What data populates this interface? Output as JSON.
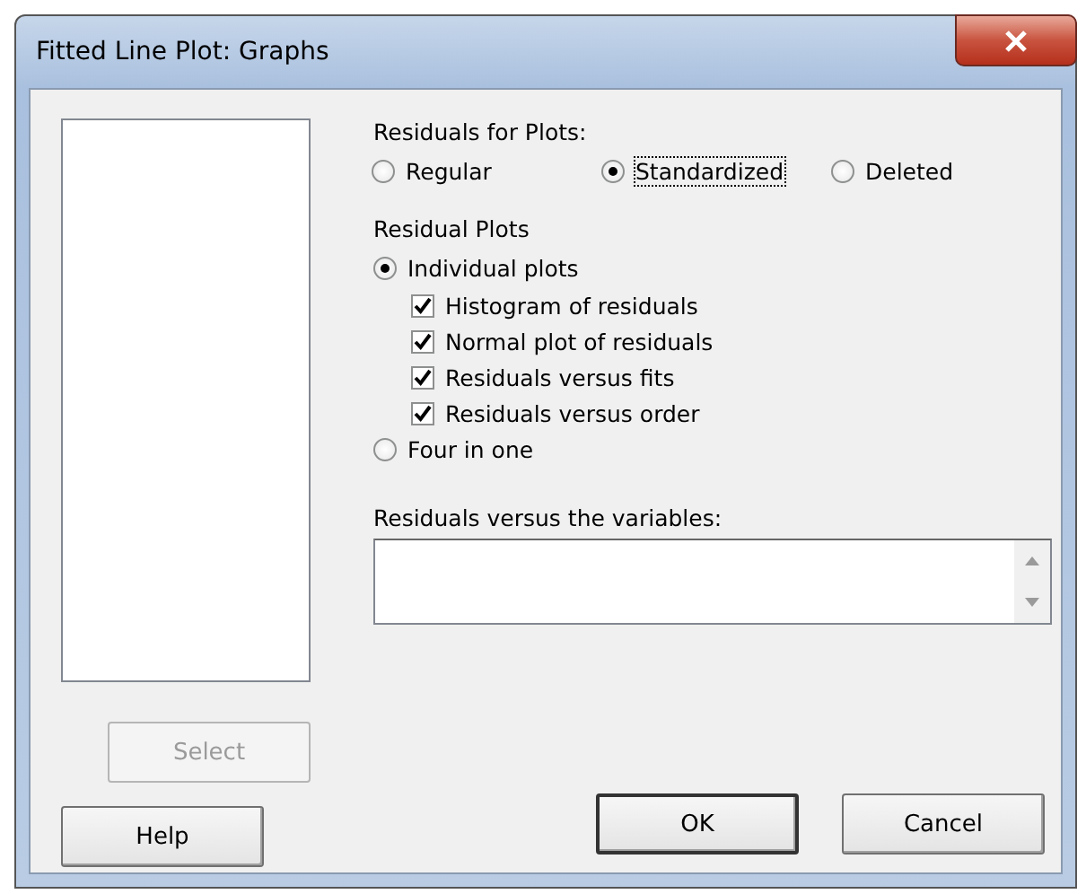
{
  "window": {
    "title": "Fitted Line Plot: Graphs"
  },
  "residuals_for_plots": {
    "label": "Residuals for Plots:",
    "options": [
      {
        "label": "Regular",
        "selected": false
      },
      {
        "label": "Standardized",
        "selected": true
      },
      {
        "label": "Deleted",
        "selected": false
      }
    ]
  },
  "residual_plots": {
    "label": "Residual Plots",
    "options": [
      {
        "label": "Individual plots",
        "selected": true,
        "children": [
          {
            "label": "Histogram of residuals",
            "checked": true
          },
          {
            "label": "Normal plot of residuals",
            "checked": true
          },
          {
            "label": "Residuals versus fits",
            "checked": true
          },
          {
            "label": "Residuals versus order",
            "checked": true
          }
        ]
      },
      {
        "label": "Four in one",
        "selected": false
      }
    ]
  },
  "variables": {
    "label": "Residuals versus the variables:"
  },
  "buttons": [
    {
      "label": "Select",
      "kind": "select",
      "disabled": true
    },
    {
      "label": "Help",
      "kind": "help",
      "disabled": false
    },
    {
      "label": "OK",
      "kind": "ok",
      "disabled": false
    },
    {
      "label": "Cancel",
      "kind": "cancel",
      "disabled": false
    }
  ]
}
